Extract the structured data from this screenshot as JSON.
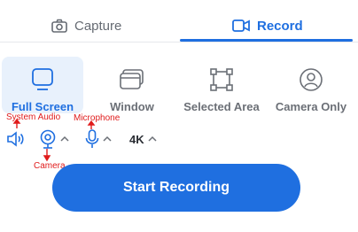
{
  "tabs": [
    {
      "label": "Capture",
      "icon": "camera-icon",
      "active": false
    },
    {
      "label": "Record",
      "icon": "video-camera-icon",
      "active": true
    }
  ],
  "modes": [
    {
      "label": "Full Screen",
      "icon": "monitor-icon",
      "selected": true
    },
    {
      "label": "Window",
      "icon": "window-icon",
      "selected": false
    },
    {
      "label": "Selected Area",
      "icon": "selected-area-icon",
      "selected": false
    },
    {
      "label": "Camera Only",
      "icon": "person-icon",
      "selected": false
    }
  ],
  "annotations": {
    "system_audio": "System Audio",
    "microphone": "Microphone",
    "camera": "Camera"
  },
  "controls": {
    "resolution": "4K"
  },
  "start_button": {
    "label": "Start Recording"
  },
  "colors": {
    "accent": "#1f6fe0",
    "selected_bg": "#e8f1fc",
    "annotation": "#e01b1b",
    "muted_text": "#6b6f76"
  }
}
